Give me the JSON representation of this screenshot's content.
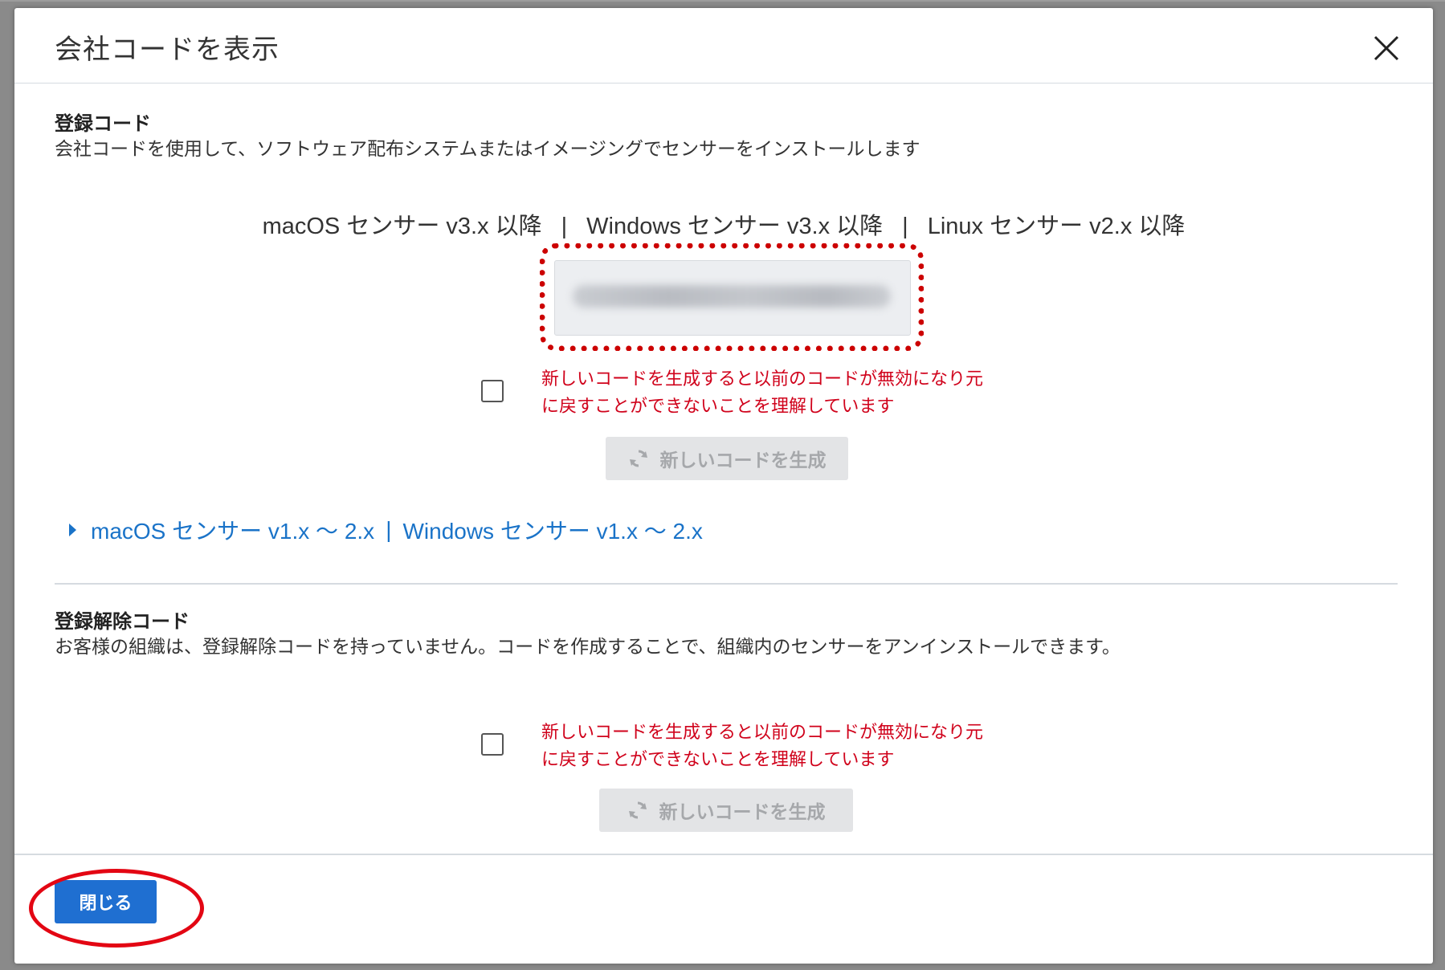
{
  "dialog": {
    "title": "会社コードを表示"
  },
  "registration": {
    "title": "登録コード",
    "description": "会社コードを使用して、ソフトウェア配布システムまたはイメージングでセンサーをインストールします",
    "sensor_versions": [
      "macOS センサー v3.x 以降",
      "Windows センサー v3.x 以降",
      "Linux センサー v2.x 以降"
    ],
    "separator": "|",
    "warning_line1": "新しいコードを生成すると以前のコードが無効になり元",
    "warning_line2": "に戻すことができないことを理解しています",
    "generate_label": "新しいコードを生成",
    "legacy_link": {
      "part1": "macOS センサー v1.x ～ 2.x",
      "separator": "|",
      "part2": "Windows センサー v1.x ～ 2.x"
    }
  },
  "unregistration": {
    "title": "登録解除コード",
    "description": "お客様の組織は、登録解除コードを持っていません。コードを作成することで、組織内のセンサーをアンインストールできます。",
    "warning_line1": "新しいコードを生成すると以前のコードが無効になり元",
    "warning_line2": "に戻すことができないことを理解しています",
    "generate_label": "新しいコードを生成"
  },
  "footer": {
    "close_label": "閉じる"
  },
  "colors": {
    "primary": "#1f6fd1",
    "link": "#1a73c8",
    "warning": "#d0021b",
    "annotation": "#e30613"
  }
}
